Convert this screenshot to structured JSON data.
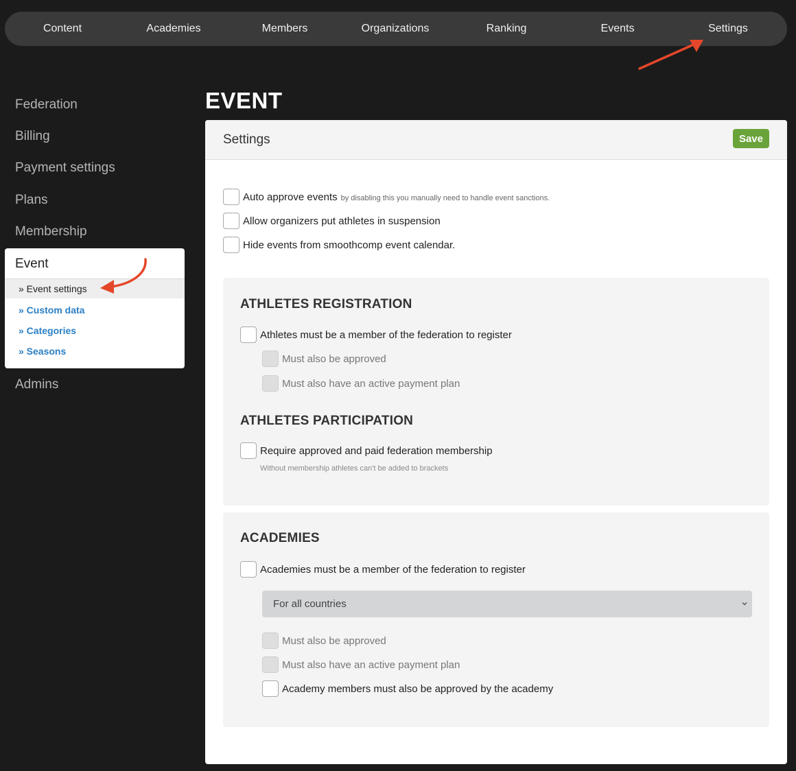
{
  "topnav": {
    "items": [
      "Content",
      "Academies",
      "Members",
      "Organizations",
      "Ranking",
      "Events",
      "Settings"
    ]
  },
  "sidebar": {
    "items": [
      "Federation",
      "Billing",
      "Payment settings",
      "Plans",
      "Membership"
    ],
    "active_group": "Event",
    "subitems": [
      "» Event settings",
      "» Custom data",
      "» Categories",
      "» Seasons"
    ],
    "after": "Admins"
  },
  "main": {
    "title": "EVENT",
    "card_title": "Settings",
    "save_label": "Save",
    "general": {
      "auto_approve": "Auto approve events",
      "auto_approve_hint": "by disabling this you manually need to handle event sanctions.",
      "allow_suspension": "Allow organizers put athletes in suspension",
      "hide_events": "Hide events from smoothcomp event calendar."
    },
    "athletes_registration": {
      "heading": "ATHLETES REGISTRATION",
      "must_member": "Athletes must be a member of the federation to register",
      "must_approved": "Must also be approved",
      "must_payment": "Must also have an active payment plan"
    },
    "athletes_participation": {
      "heading": "ATHLETES PARTICIPATION",
      "require_membership": "Require approved and paid federation membership",
      "note": "Without membership athletes can't be added to brackets"
    },
    "academies": {
      "heading": "ACADEMIES",
      "must_member": "Academies must be a member of the federation to register",
      "country_select": "For all countries",
      "must_approved": "Must also be approved",
      "must_payment": "Must also have an active payment plan",
      "members_approved": "Academy members must also be approved by the academy"
    }
  },
  "colors": {
    "background": "#1b1b1b",
    "nav": "#3a3a3a",
    "save": "#6aa33a",
    "link": "#2a7fc4",
    "annotation": "#e5472a"
  }
}
